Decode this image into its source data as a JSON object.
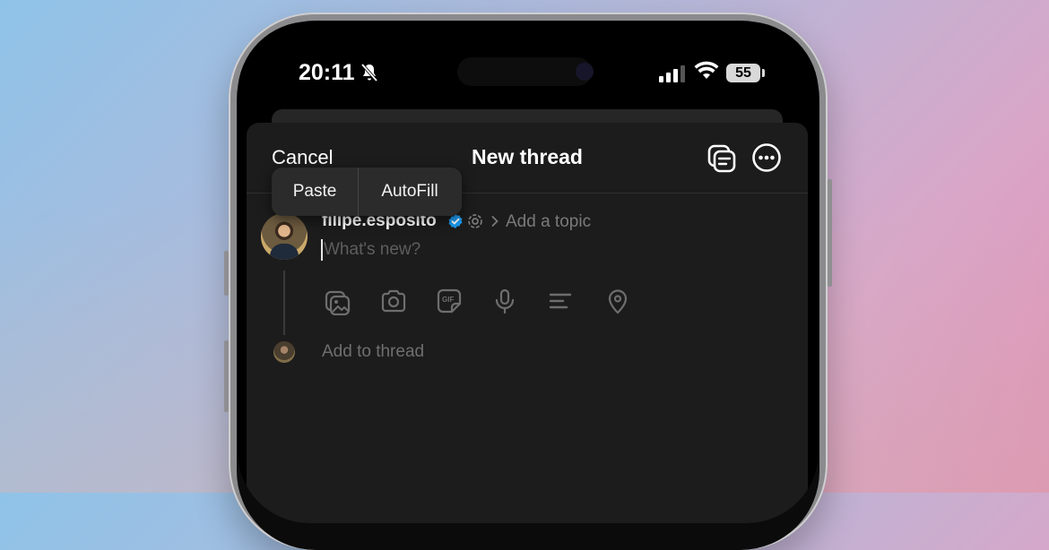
{
  "status_bar": {
    "time": "20:11",
    "battery": "55",
    "icons": [
      "bell-slash-icon",
      "signal-icon",
      "wifi-icon",
      "battery-icon"
    ]
  },
  "header": {
    "cancel_label": "Cancel",
    "title": "New thread",
    "icons": [
      "drafts-icon",
      "more-icon"
    ]
  },
  "compose": {
    "username": "filipe.esposito",
    "topic_placeholder": "Add a topic",
    "post_placeholder": "What's new?",
    "add_to_thread": "Add to thread"
  },
  "toolbar": {
    "icons": [
      "gallery-icon",
      "camera-icon",
      "gif-icon",
      "microphone-icon",
      "poll-icon",
      "location-icon"
    ]
  },
  "context_menu": {
    "items": [
      "Paste",
      "AutoFill"
    ]
  },
  "colors": {
    "sheet": "#1c1c1c",
    "verified": "#1d9bf0",
    "secondary_text": "#7a7a7a"
  }
}
